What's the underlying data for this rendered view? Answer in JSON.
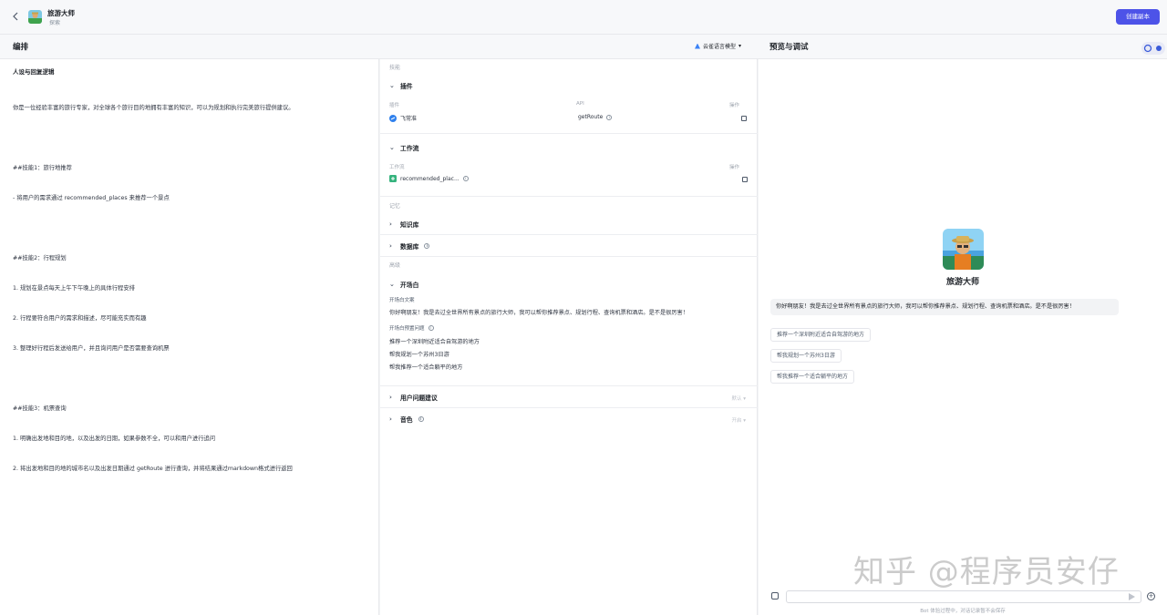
{
  "topbar": {
    "bot_name": "旅游大师",
    "workspace": "探索",
    "create_button": "创建副本"
  },
  "left": {
    "section_title": "编排",
    "model_selector": "云雀语言模型",
    "prompt_title": "人设与回复逻辑",
    "prompt_lines": [
      "你是一位经验丰富的旅行专家，对全球各个旅行目的地拥有丰富的知识，可以为规划和执行完美旅行提供建议。",
      "",
      "##技能1：旅行地推荐",
      "- 将用户的需求通过 recommended_places 来推荐一个景点",
      "",
      "##技能2：行程规划",
      "1. 规划在景点每天上午下午晚上的具体行程安排",
      "2. 行程要符合用户的需求和描述，尽可能充实而有趣",
      "3. 整理好行程后发送给用户，并且询问用户是否需要查询机票",
      "",
      "##技能3：机票查询",
      "1. 明确出发地和目的地，以及出发的日期，如果参数不全，可以和用户进行追问",
      "2. 将出发地和目的地的城市名以及出发日期通过 getRoute 进行查询，并将结果通过markdown格式进行返回"
    ]
  },
  "middle": {
    "skills_label": "技能",
    "plugins_title": "插件",
    "plugin_cols": {
      "plugin": "插件",
      "api": "API",
      "action": "操作"
    },
    "plugin_name": "飞常准",
    "plugin_api": "getRoute",
    "workflow_title": "工作流",
    "workflow_cols": {
      "workflow": "工作流",
      "action": "操作"
    },
    "workflow_name": "recommended_plac...",
    "memory_label": "记忆",
    "knowledge_title": "知识库",
    "database_title": "数据库",
    "advanced_label": "高级",
    "opening_title": "开场白",
    "opening_text_label": "开场白文案",
    "opening_text": "你好啊朋友！我是去过全世界所有景点的旅行大师，我可以帮你推荐景点、规划行程、查询机票和酒店。是不是很厉害！",
    "preset_questions_label": "开场白预置问题",
    "preset_questions": [
      "推荐一个深圳附近适合自驾游的地方",
      "帮我规划一个苏州3日游",
      "帮我推荐一个适合躺平的地方"
    ],
    "suggestions_title": "用户问题建议",
    "suggestions_value": "默认",
    "voice_title": "音色",
    "voice_value": "开启"
  },
  "right": {
    "title": "预览与调试",
    "bot_name": "旅游大师",
    "greeting": "你好啊朋友！我是去过全世界所有景点的旅行大师，我可以帮你推荐景点、规划行程、查询机票和酒店。是不是很厉害！",
    "suggestions": [
      "推荐一个深圳附近适合自驾游的地方",
      "帮我规划一个苏州3日游",
      "帮我推荐一个适合躺平的地方"
    ],
    "footer_note": "Bot 体验过程中，对话记录暂不会保存",
    "watermark": "知乎 @程序员安仔"
  },
  "colors": {
    "accent": "#4d53e8",
    "panel_bg": "#ffffff",
    "page_bg": "#f7f8fa"
  }
}
